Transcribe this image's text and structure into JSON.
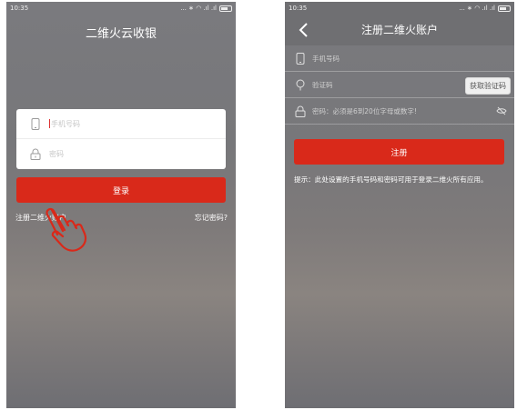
{
  "login": {
    "status_time": "10:35",
    "status_icons": "... ∗ ◠ .ıl .ıl",
    "title": "二维火云收银",
    "phone_placeholder": "手机号码",
    "password_placeholder": "密码",
    "login_button": "登录",
    "register_link": "注册二维火账户",
    "forgot_link": "忘记密码?"
  },
  "register": {
    "status_time": "10:35",
    "status_icons": "... ∗ ◠ .ıl .ıl",
    "title": "注册二维火账户",
    "phone_placeholder": "手机号码",
    "code_placeholder": "验证码",
    "get_code_button": "获取验证码",
    "password_placeholder": "密码：必须是6到20位字母或数字!",
    "submit_button": "注册",
    "tip": "提示：此处设置的手机号码和密码可用于登录二维火所有应用。"
  },
  "colors": {
    "accent_red": "#d9291a",
    "screen_gray": "#77777a",
    "header_gray": "#6f6f72"
  },
  "icons": [
    "phone-icon",
    "lock-icon",
    "back-arrow-icon",
    "location-pin-icon",
    "eye-hidden-icon",
    "pointing-hand-icon",
    "battery-icon"
  ]
}
